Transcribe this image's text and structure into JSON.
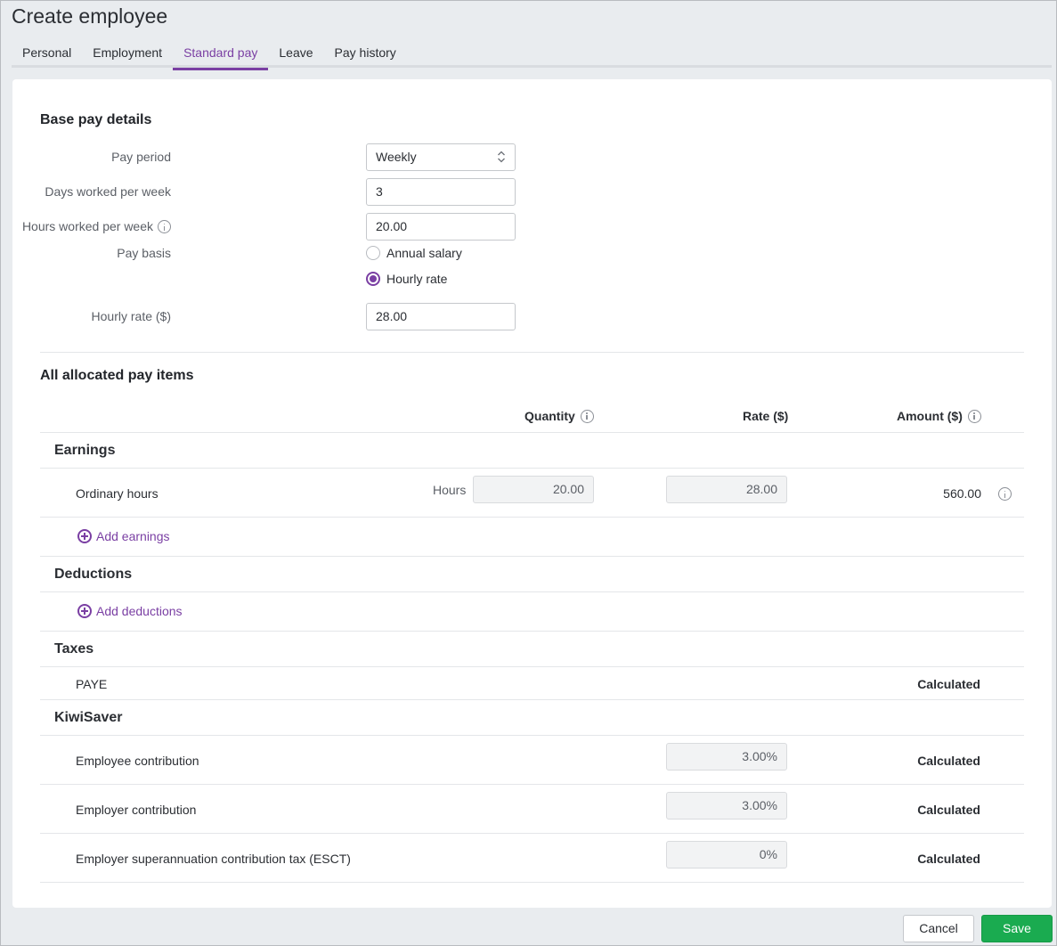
{
  "page": {
    "title": "Create employee"
  },
  "tabs": [
    {
      "label": "Personal",
      "active": false
    },
    {
      "label": "Employment",
      "active": false
    },
    {
      "label": "Standard pay",
      "active": true
    },
    {
      "label": "Leave",
      "active": false
    },
    {
      "label": "Pay history",
      "active": false
    }
  ],
  "base_pay": {
    "title": "Base pay details",
    "pay_period": {
      "label": "Pay period",
      "value": "Weekly"
    },
    "days_per_week": {
      "label": "Days worked per week",
      "value": "3"
    },
    "hours_per_week": {
      "label": "Hours worked per week",
      "value": "20.00"
    },
    "pay_basis": {
      "label": "Pay basis",
      "options": [
        {
          "label": "Annual salary",
          "selected": false
        },
        {
          "label": "Hourly rate",
          "selected": true
        }
      ]
    },
    "hourly_rate": {
      "label": "Hourly rate ($)",
      "value": "28.00"
    }
  },
  "pay_items": {
    "title": "All allocated pay items",
    "columns": {
      "quantity": "Quantity",
      "rate": "Rate ($)",
      "amount": "Amount ($)"
    },
    "earnings": {
      "title": "Earnings",
      "items": [
        {
          "label": "Ordinary hours",
          "unit": "Hours",
          "quantity": "20.00",
          "rate": "28.00",
          "amount": "560.00"
        }
      ],
      "add_label": "Add earnings"
    },
    "deductions": {
      "title": "Deductions",
      "add_label": "Add deductions"
    },
    "taxes": {
      "title": "Taxes",
      "items": [
        {
          "label": "PAYE",
          "amount": "Calculated"
        }
      ]
    },
    "kiwisaver": {
      "title": "KiwiSaver",
      "items": [
        {
          "label": "Employee contribution",
          "rate": "3.00%",
          "amount": "Calculated"
        },
        {
          "label": "Employer contribution",
          "rate": "3.00%",
          "amount": "Calculated"
        },
        {
          "label": "Employer superannuation contribution tax (ESCT)",
          "rate": "0%",
          "amount": "Calculated"
        }
      ]
    }
  },
  "footer": {
    "cancel_label": "Cancel",
    "save_label": "Save"
  },
  "colors": {
    "accent": "#7a3fa3",
    "save": "#1aab50"
  }
}
